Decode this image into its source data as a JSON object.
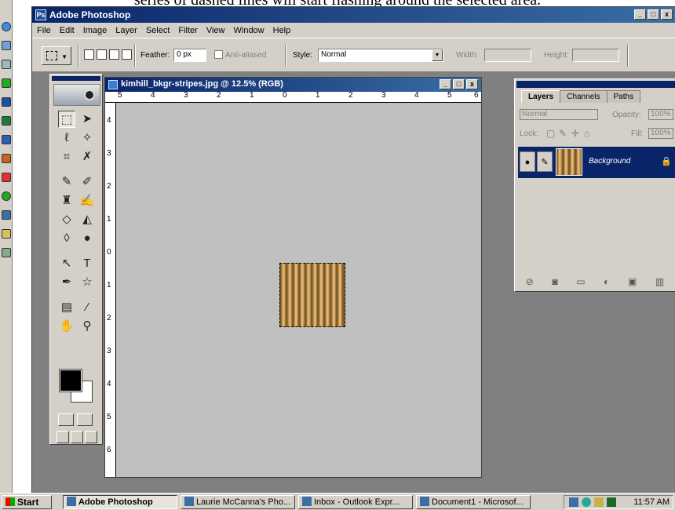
{
  "caption": "series of dashed lines will start flashing around the selected area.",
  "app": {
    "title": "Adobe Photoshop",
    "window_buttons": [
      "_",
      "□",
      "x"
    ]
  },
  "menu": [
    "File",
    "Edit",
    "Image",
    "Layer",
    "Select",
    "Filter",
    "View",
    "Window",
    "Help"
  ],
  "options": {
    "feather_label": "Feather:",
    "feather_value": "0 px",
    "antialiased_label": "Anti-aliased",
    "style_label": "Style:",
    "style_value": "Normal",
    "width_label": "Width:",
    "height_label": "Height:"
  },
  "document": {
    "title": "kimhill_bkgr-stripes.jpg @ 12.5% (RGB)",
    "window_buttons": [
      "_",
      "□",
      "x"
    ],
    "ruler_top": [
      "5",
      "4",
      "3",
      "2",
      "1",
      "0",
      "1",
      "2",
      "3",
      "4",
      "5",
      "6"
    ],
    "ruler_left": [
      "4",
      "3",
      "2",
      "1",
      "0",
      "1",
      "2",
      "3",
      "4",
      "5",
      "6"
    ]
  },
  "layers_palette": {
    "tabs": [
      "Layers",
      "Channels",
      "Paths"
    ],
    "blend_mode": "Normal",
    "opacity_label": "Opacity:",
    "opacity_value": "100%",
    "lock_label": "Lock:",
    "fill_label": "Fill:",
    "fill_value": "100%",
    "layer_name": "Background"
  },
  "taskbar": {
    "start": "Start",
    "tasks": [
      "Adobe Photoshop",
      "Laurie McCanna's Pho...",
      "Inbox - Outlook Expr...",
      "Document1 - Microsof..."
    ],
    "clock": "11:57 AM"
  },
  "colors": {
    "titlebar": "#0a246a",
    "chrome": "#d4d0c8",
    "workspace": "#808080",
    "canvas": "#c0c0c0",
    "foreground_swatch": "#000000",
    "background_swatch": "#ffffff"
  },
  "icons": [
    "photoshop-icon",
    "rectangular-marquee-icon",
    "move-icon",
    "lasso-icon",
    "magic-wand-icon",
    "crop-icon",
    "slice-icon",
    "healing-brush-icon",
    "brush-icon",
    "clone-stamp-icon",
    "history-brush-icon",
    "eraser-icon",
    "paint-bucket-icon",
    "blur-icon",
    "dodge-icon",
    "path-selection-icon",
    "type-icon",
    "pen-icon",
    "shape-icon",
    "notes-icon",
    "eyedropper-icon",
    "hand-icon",
    "zoom-icon",
    "eye-icon",
    "lock-icon"
  ]
}
